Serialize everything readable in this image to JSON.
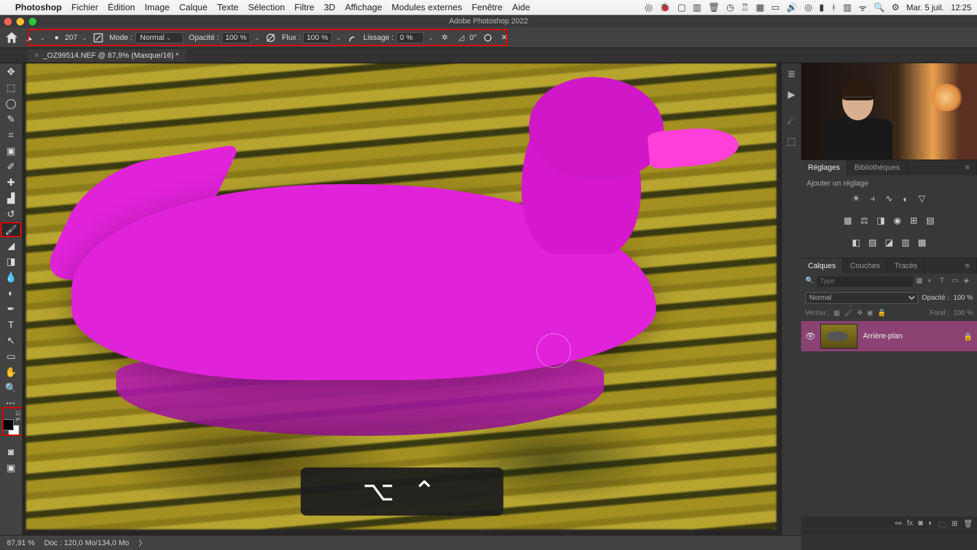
{
  "macos": {
    "app_name": "Photoshop",
    "menus": [
      "Fichier",
      "Édition",
      "Image",
      "Calque",
      "Texte",
      "Sélection",
      "Filtre",
      "3D",
      "Affichage",
      "Modules externes",
      "Fenêtre",
      "Aide"
    ],
    "date": "Mar. 5 juil.",
    "time": "12:25"
  },
  "window": {
    "title": "Adobe Photoshop 2022"
  },
  "options": {
    "brush_size": "207",
    "mode_label": "Mode :",
    "mode_value": "Normal",
    "opacity_label": "Opacité :",
    "opacity_value": "100 %",
    "flow_label": "Flux :",
    "flow_value": "100 %",
    "smoothing_label": "Lissage :",
    "smoothing_value": "0 %",
    "angle_label": "",
    "angle_value": "0°"
  },
  "document": {
    "tab_title": "_OZ99514.NEF @ 87,9% (Masque/16) *"
  },
  "keystroke": "⌥ ⌃",
  "panels": {
    "reglages": {
      "tab1": "Réglages",
      "tab2": "Bibliothèques",
      "add_label": "Ajouter un réglage"
    },
    "layers": {
      "tab1": "Calques",
      "tab2": "Couches",
      "tab3": "Tracés",
      "type_placeholder": "Type",
      "blend_mode": "Normal",
      "opacity_label": "Opacité :",
      "opacity_value": "100 %",
      "lock_label": "Verrou :",
      "fill_label": "Fond :",
      "fill_value": "100 %",
      "layer0_name": "Arrière-plan"
    }
  },
  "status": {
    "zoom": "87,91 %",
    "doc_info": "Doc : 120,0 Mo/134,0 Mo"
  }
}
